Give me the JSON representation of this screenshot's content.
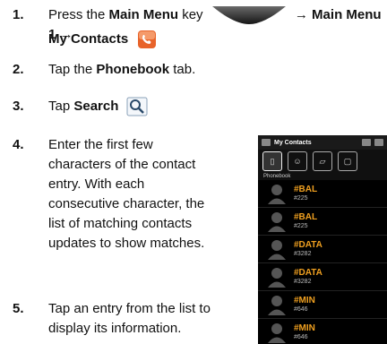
{
  "steps": [
    {
      "n": "1.",
      "pre": "Press the ",
      "main_menu": "Main Menu",
      "key_word": " key",
      "arrow1": "→ Main Menu 1 →",
      "my_contacts": "My Contacts"
    },
    {
      "n": "2.",
      "pre": "Tap the ",
      "bold": "Phonebook",
      "post": " tab."
    },
    {
      "n": "3.",
      "pre": "Tap ",
      "bold": "Search"
    },
    {
      "n": "4.",
      "lines": [
        "Enter the first few",
        "characters of the contact",
        "entry. With each",
        "consecutive character, the",
        "list of matching contacts",
        "updates to show matches."
      ]
    },
    {
      "n": "5.",
      "lines": [
        "Tap an entry from the list to",
        "display its information."
      ]
    }
  ],
  "phone": {
    "title": "My Contacts",
    "tab_caption": "Phonebook",
    "contacts": [
      {
        "name": "#BAL",
        "number": "#225"
      },
      {
        "name": "#BAL",
        "number": "#225"
      },
      {
        "name": "#DATA",
        "number": "#3282"
      },
      {
        "name": "#DATA",
        "number": "#3282"
      },
      {
        "name": "#MIN",
        "number": "#646"
      },
      {
        "name": "#MIN",
        "number": "#646"
      }
    ]
  },
  "colors": {
    "contact_name": "#f0a020",
    "contacts_icon": "#e8632a",
    "search_icon_border": "#8aa0b8"
  }
}
